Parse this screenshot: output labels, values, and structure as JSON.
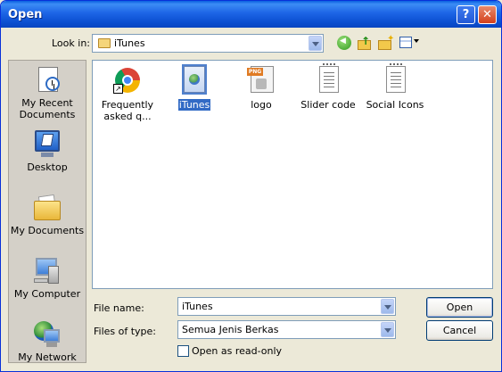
{
  "window": {
    "title": "Open",
    "help_glyph": "?",
    "close_glyph": "✕"
  },
  "look_in": {
    "label": "Look in:",
    "value": "iTunes"
  },
  "toolbar": {
    "icons": [
      "back-icon",
      "up-folder-icon",
      "new-folder-icon",
      "views-menu-icon"
    ]
  },
  "places": [
    {
      "label": "My Recent Documents",
      "icon": "recent-documents-icon"
    },
    {
      "label": "Desktop",
      "icon": "desktop-icon"
    },
    {
      "label": "My Documents",
      "icon": "my-documents-icon"
    },
    {
      "label": "My Computer",
      "icon": "my-computer-icon"
    },
    {
      "label": "My Network Places",
      "icon": "network-places-icon"
    }
  ],
  "files": [
    {
      "label": "Frequently asked q...",
      "icon": "chrome-shortcut-icon",
      "selected": false
    },
    {
      "label": "iTunes",
      "icon": "web-link-icon",
      "selected": true
    },
    {
      "label": "logo",
      "icon": "png-image-icon",
      "selected": false
    },
    {
      "label": "Slider code",
      "icon": "text-document-icon",
      "selected": false
    },
    {
      "label": "Social Icons",
      "icon": "text-document-icon",
      "selected": false
    }
  ],
  "file_name": {
    "label": "File name:",
    "value": "iTunes"
  },
  "files_of_type": {
    "label": "Files of type:",
    "value": "Semua Jenis Berkas"
  },
  "read_only": {
    "label": "Open as read-only",
    "checked": false
  },
  "buttons": {
    "open": "Open",
    "cancel": "Cancel"
  }
}
